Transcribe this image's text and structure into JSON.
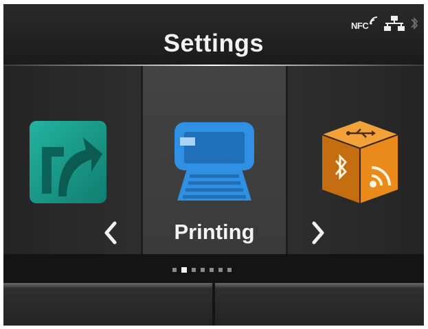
{
  "header": {
    "title": "Settings",
    "status_icons": {
      "nfc_label": "NFC",
      "nfc_icon": "nfc-signal-icon",
      "lan_icon": "lan-network-icon",
      "bluetooth_icon": "bluetooth-icon"
    }
  },
  "carousel": {
    "left_item": {
      "icon": "shortcut-arrow-icon",
      "color": "#1a9d8c"
    },
    "center_item": {
      "label": "Printing",
      "icon": "printer-icon",
      "color": "#2f8fe3"
    },
    "right_item": {
      "icon": "interface-cube-icon",
      "color": "#e98a1a"
    },
    "prev_icon": "chevron-left-icon",
    "next_icon": "chevron-right-icon"
  },
  "page_indicator": {
    "count": 7,
    "active_index": 1
  },
  "colors": {
    "background": "#141414",
    "title_text": "#f2f2f2",
    "tile_selected": "#3f3f3f"
  }
}
